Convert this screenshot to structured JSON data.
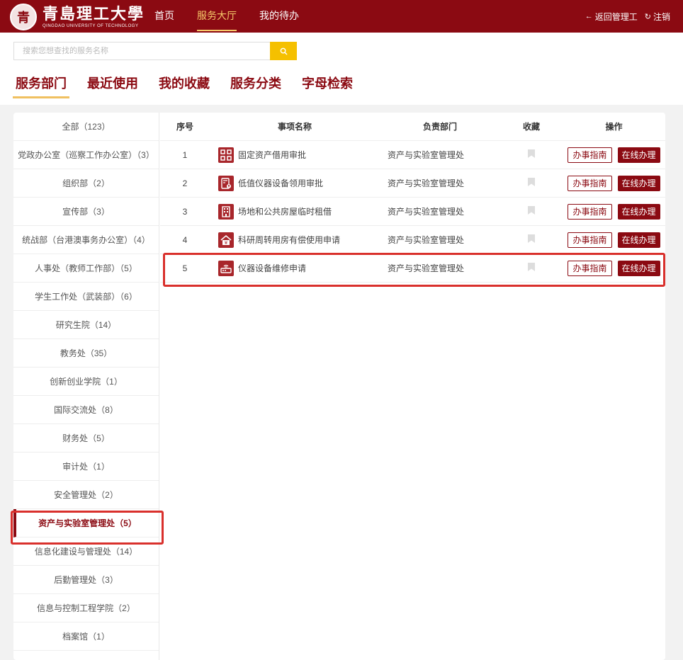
{
  "header": {
    "logo_cn": "青島理工大學",
    "logo_en": "QINGDAO UNIVERSITY OF TECHNOLOGY",
    "seal_char": "青",
    "nav": [
      "首页",
      "服务大厅",
      "我的待办"
    ],
    "back_label": "返回管理工",
    "logout_label": "注销"
  },
  "search": {
    "placeholder": "搜索您想查找的服务名称"
  },
  "tabs": [
    "服务部门",
    "最近使用",
    "我的收藏",
    "服务分类",
    "字母检索"
  ],
  "departments": [
    "全部（123）",
    "党政办公室（巡察工作办公室）（3）",
    "组织部（2）",
    "宣传部（3）",
    "统战部（台港澳事务办公室）（4）",
    "人事处（教师工作部）（5）",
    "学生工作处（武装部）（6）",
    "研究生院（14）",
    "教务处（35）",
    "创新创业学院（1）",
    "国际交流处（8）",
    "财务处（5）",
    "审计处（1）",
    "安全管理处（2）",
    "资产与实验室管理处（5）",
    "信息化建设与管理处（14）",
    "后勤管理处（3）",
    "信息与控制工程学院（2）",
    "档案馆（1）"
  ],
  "table": {
    "headers": {
      "no": "序号",
      "name": "事项名称",
      "dept": "负责部门",
      "fav": "收藏",
      "op": "操作"
    },
    "rows": [
      {
        "no": "1",
        "name": "固定资产借用审批",
        "dept": "资产与实验室管理处",
        "icon": "qr-grid-icon"
      },
      {
        "no": "2",
        "name": "低值仪器设备领用审批",
        "dept": "资产与实验室管理处",
        "icon": "calculator-icon"
      },
      {
        "no": "3",
        "name": "场地和公共房屋临时租借",
        "dept": "资产与实验室管理处",
        "icon": "building-icon"
      },
      {
        "no": "4",
        "name": "科研周转用房有偿使用申请",
        "dept": "资产与实验室管理处",
        "icon": "house-yuan-icon"
      },
      {
        "no": "5",
        "name": "仪器设备维修申请",
        "dept": "资产与实验室管理处",
        "icon": "router-icon"
      }
    ],
    "guide_label": "办事指南",
    "online_label": "在线办理"
  },
  "colors": {
    "brand": "#8b0a12",
    "accent": "#f5c000",
    "highlight": "#d9302c"
  }
}
